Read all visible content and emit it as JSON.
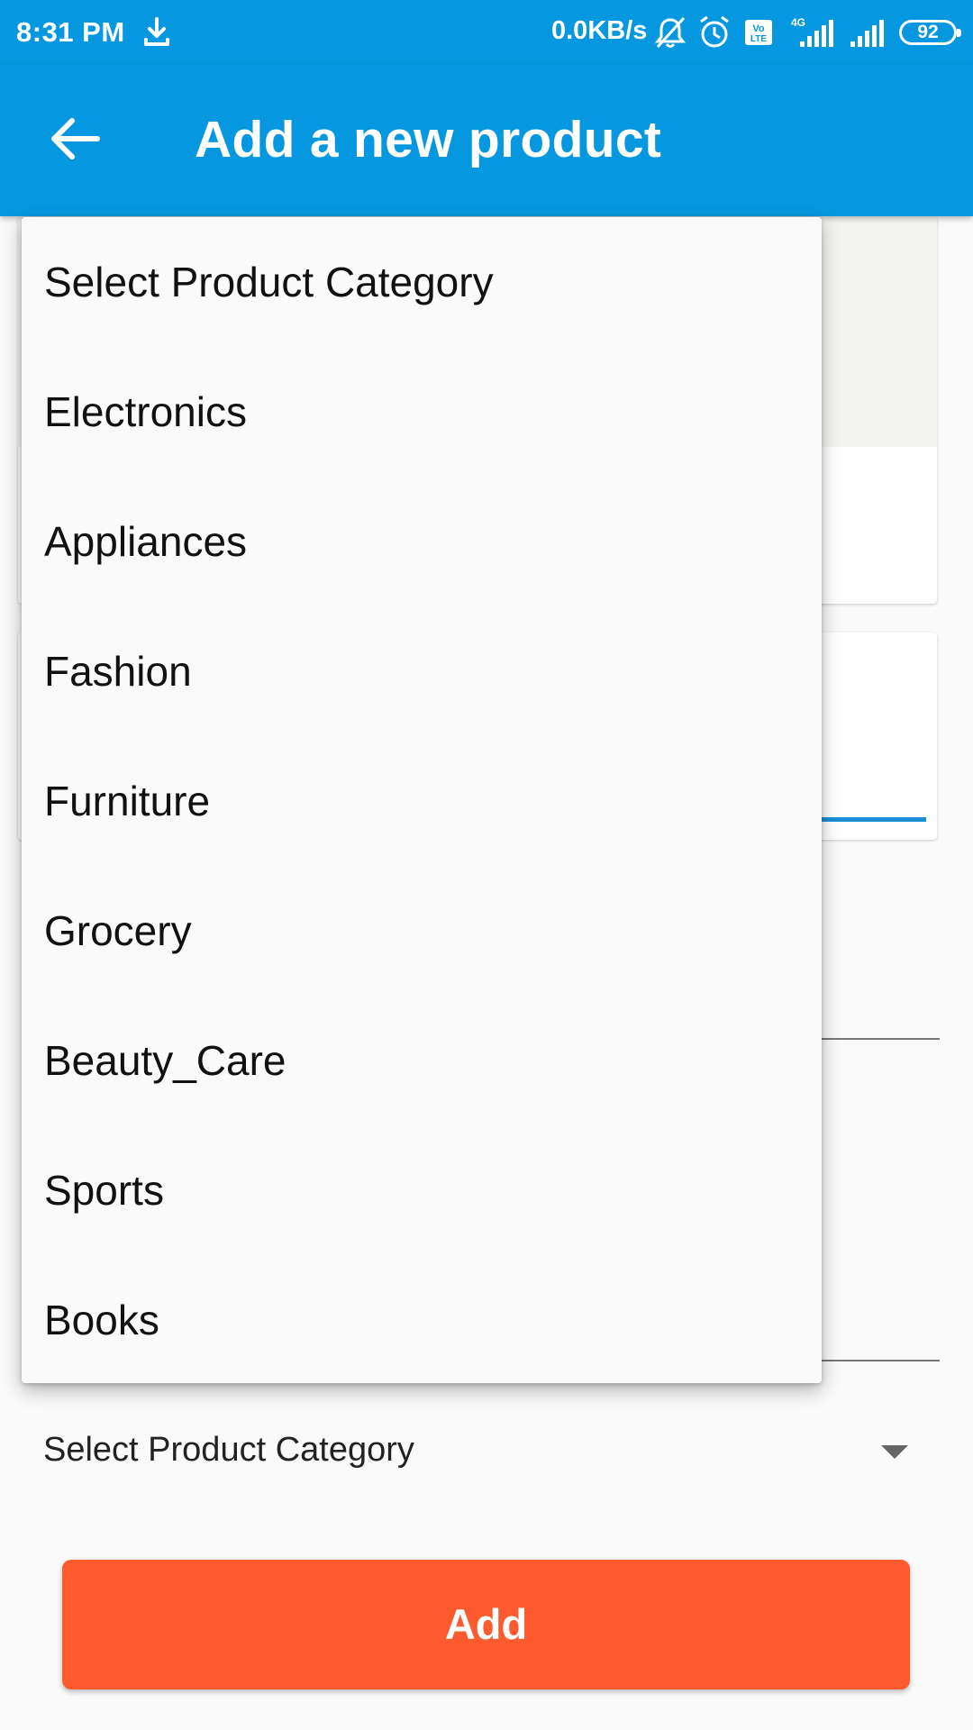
{
  "status_bar": {
    "time": "8:31 PM",
    "network_speed": "0.0KB/s",
    "battery": "92",
    "network_type": "4G",
    "volte_label": "Vo LTE",
    "icons": [
      "download-icon",
      "mute-bell-icon",
      "alarm-icon",
      "volte-icon",
      "signal-4g-icon",
      "signal-icon",
      "battery-icon"
    ]
  },
  "app_bar": {
    "title": "Add a new product",
    "back_icon": "arrow-left-icon"
  },
  "category_select": {
    "selected": "Select Product Category",
    "arrow_icon": "dropdown-arrow-icon"
  },
  "dropdown": {
    "options": [
      "Select Product Category",
      "Electronics",
      "Appliances",
      "Fashion",
      "Furniture",
      "Grocery",
      "Beauty_Care",
      "Sports",
      "Books"
    ]
  },
  "add_button": {
    "label": "Add"
  },
  "colors": {
    "primary": "#0597e0",
    "accent": "#fd5a2e",
    "focus_underline": "#1a8fd8"
  }
}
